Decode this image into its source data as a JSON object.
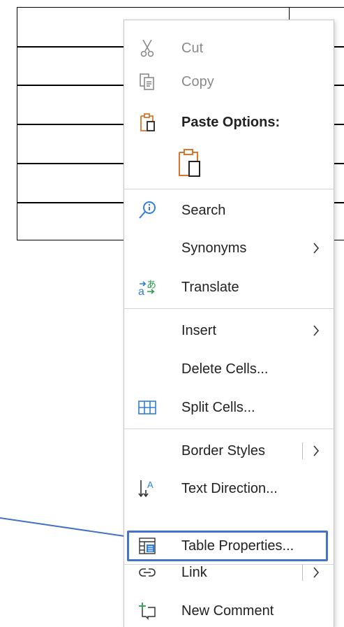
{
  "menu": {
    "cut": {
      "label": "Cut",
      "disabled": true,
      "icon": "scissors-icon"
    },
    "copy": {
      "label": "Copy",
      "disabled": true,
      "icon": "copy-icon"
    },
    "paste_options": {
      "label": "Paste Options:",
      "icon": "clipboard-icon"
    },
    "paste_keep": {
      "icon": "paste-keep-text-icon"
    },
    "search": {
      "label": "Search",
      "icon": "search-icon"
    },
    "synonyms": {
      "label": "Synonyms",
      "has_submenu": true
    },
    "translate": {
      "label": "Translate",
      "icon": "translate-icon"
    },
    "insert": {
      "label": "Insert",
      "has_submenu": true
    },
    "delete_cells": {
      "label": "Delete Cells..."
    },
    "split_cells": {
      "label": "Split Cells...",
      "icon": "split-cells-icon"
    },
    "border_styles": {
      "label": "Border Styles",
      "has_submenu": true
    },
    "text_direction": {
      "label": "Text Direction...",
      "icon": "text-direction-icon"
    },
    "table_properties": {
      "label": "Table Properties...",
      "icon": "table-properties-icon",
      "highlighted": true
    },
    "link": {
      "label": "Link",
      "icon": "link-icon",
      "has_submenu": true
    },
    "new_comment": {
      "label": "New Comment",
      "icon": "new-comment-icon"
    }
  },
  "colors": {
    "highlight_border": "#4472c4",
    "accent_orange": "#d9762c",
    "accent_blue": "#2f7fd6",
    "accent_green": "#2e9a4a",
    "disabled_text": "#8a8a8a"
  }
}
